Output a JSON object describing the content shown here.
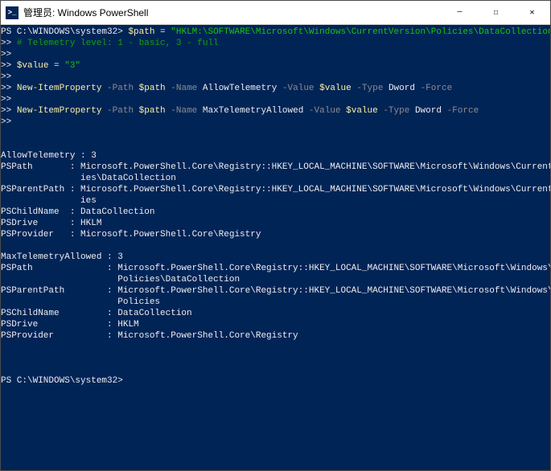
{
  "titlebar": {
    "icon_text": ">_",
    "title": "管理员: Windows PowerShell",
    "minimize": "—",
    "maximize": "☐",
    "close": "✕"
  },
  "terminal": {
    "cont": ">>",
    "prompt1": "PS C:\\WINDOWS\\system32>",
    "prompt_end": "PS C:\\WINDOWS\\system32>",
    "line1_var": "$path",
    "line1_eq": " = ",
    "line1_str": "\"HKLM:\\SOFTWARE\\Microsoft\\Windows\\CurrentVersion\\Policies\\DataCollection\"",
    "line2_cmt": "# Telemetry level: 1 - basic, 3 - full",
    "line3_var": "$value",
    "line3_eq": " = ",
    "line3_str": "\"3\"",
    "line4_cmd": "New-ItemProperty",
    "line4_f1": " -Path ",
    "line4_v1": "$path",
    "line4_f2": " -Name ",
    "line4_a2": "AllowTelemetry",
    "line4_f3": " -Value ",
    "line4_v3": "$value",
    "line4_f4": " -Type ",
    "line4_a4": "Dword",
    "line4_f5": " -Force",
    "line5_cmd": "New-ItemProperty",
    "line5_f1": " -Path ",
    "line5_v1": "$path",
    "line5_f2": " -Name ",
    "line5_a2": "MaxTelemetryAllowed",
    "line5_f3": " -Value ",
    "line5_v3": "$value",
    "line5_f4": " -Type ",
    "line5_a4": "Dword",
    "line5_f5": " -Force",
    "out1": {
      "h1": "AllowTelemetry : 3",
      "r1": "PSPath       : Microsoft.PowerShell.Core\\Registry::HKEY_LOCAL_MACHINE\\SOFTWARE\\Microsoft\\Windows\\CurrentVersion\\Polic",
      "r1c": "               ies\\DataCollection",
      "r2": "PSParentPath : Microsoft.PowerShell.Core\\Registry::HKEY_LOCAL_MACHINE\\SOFTWARE\\Microsoft\\Windows\\CurrentVersion\\Polic",
      "r2c": "               ies",
      "r3": "PSChildName  : DataCollection",
      "r4": "PSDrive      : HKLM",
      "r5": "PSProvider   : Microsoft.PowerShell.Core\\Registry"
    },
    "out2": {
      "h1": "MaxTelemetryAllowed : 3",
      "r1": "PSPath              : Microsoft.PowerShell.Core\\Registry::HKEY_LOCAL_MACHINE\\SOFTWARE\\Microsoft\\Windows\\CurrentVersion\\",
      "r1c": "                      Policies\\DataCollection",
      "r2": "PSParentPath        : Microsoft.PowerShell.Core\\Registry::HKEY_LOCAL_MACHINE\\SOFTWARE\\Microsoft\\Windows\\CurrentVersion\\",
      "r2c": "                      Policies",
      "r3": "PSChildName         : DataCollection",
      "r4": "PSDrive             : HKLM",
      "r5": "PSProvider          : Microsoft.PowerShell.Core\\Registry"
    }
  }
}
